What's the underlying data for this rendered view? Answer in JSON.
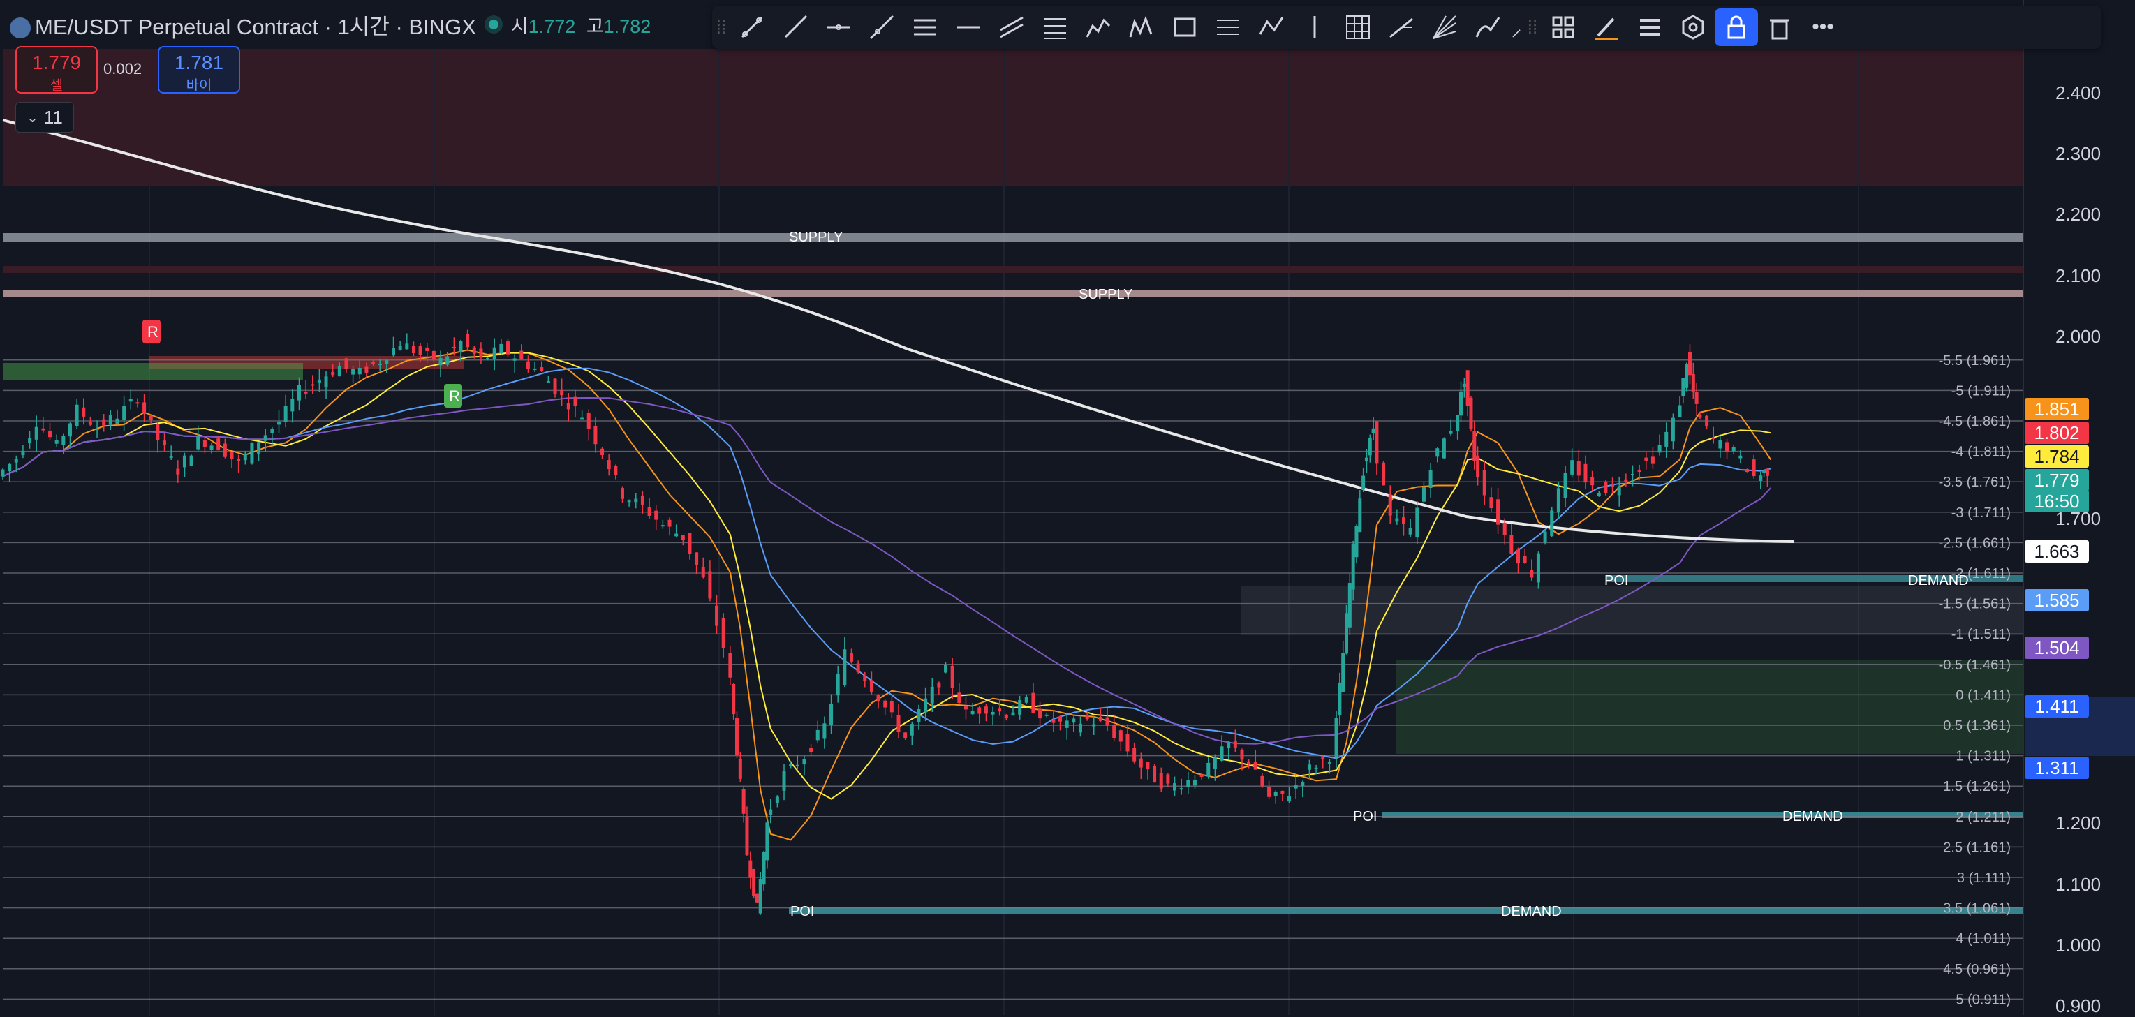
{
  "header": {
    "title": "ME/USDT Perpetual Contract · 1시간 · BINGX",
    "open_label": "시",
    "open_value": "1.772",
    "high_label": "고",
    "high_value": "1.782"
  },
  "trade": {
    "sell_price": "1.779",
    "sell_label": "셀",
    "spread": "0.002",
    "buy_price": "1.781",
    "buy_label": "바이"
  },
  "indicators_toggle": {
    "count": "11"
  },
  "toolbar": {
    "tools": [
      "trend-line",
      "ray",
      "horizontal-ray",
      "extended-line",
      "parallel-channel",
      "horizontal-line",
      "parallel-channels",
      "fib-retracement",
      "elliott-wave",
      "xabcd-pattern",
      "rectangle",
      "regression-trend",
      "abcd-pattern",
      "vertical-line",
      "grid",
      "pitchfork",
      "fan",
      "brush",
      "text"
    ],
    "right_tools": [
      "layout-icon",
      "pen-icon",
      "menu-icon",
      "settings-hex-icon",
      "lock-icon",
      "trash-icon",
      "more-icon"
    ]
  },
  "price_axis": {
    "ticks": [
      "2.400",
      "2.300",
      "2.200",
      "2.100",
      "2.000",
      "1.700",
      "1.200",
      "1.100",
      "1.000",
      "0.900"
    ],
    "tags": [
      {
        "value": "1.851",
        "color": "#f7931a"
      },
      {
        "value": "1.802",
        "color": "#f23645"
      },
      {
        "value": "1.784",
        "color": "#ffeb3b"
      },
      {
        "value": "1.779",
        "color": "#26a69a"
      },
      {
        "value": "16:50",
        "color": "#26a69a"
      },
      {
        "value": "1.663",
        "color": "#ffffff"
      },
      {
        "value": "1.585",
        "color": "#5b9cf6"
      },
      {
        "value": "1.504",
        "color": "#7e57c2"
      },
      {
        "value": "1.411",
        "color": "#2962ff"
      },
      {
        "value": "1.311",
        "color": "#2962ff"
      }
    ]
  },
  "fib_levels": [
    {
      "label": "-5.5 (1.961)",
      "price": 1.961
    },
    {
      "label": "-5 (1.911)",
      "price": 1.911
    },
    {
      "label": "-4.5 (1.861)",
      "price": 1.861
    },
    {
      "label": "-4 (1.811)",
      "price": 1.811
    },
    {
      "label": "-3.5 (1.761)",
      "price": 1.761
    },
    {
      "label": "-3 (1.711)",
      "price": 1.711
    },
    {
      "label": "-2.5 (1.661)",
      "price": 1.661
    },
    {
      "label": "-2 (1.611)",
      "price": 1.611
    },
    {
      "label": "-1.5 (1.561)",
      "price": 1.561
    },
    {
      "label": "-1 (1.511)",
      "price": 1.511
    },
    {
      "label": "-0.5 (1.461)",
      "price": 1.461
    },
    {
      "label": "0 (1.411)",
      "price": 1.411
    },
    {
      "label": "0.5 (1.361)",
      "price": 1.361
    },
    {
      "label": "1 (1.311)",
      "price": 1.311
    },
    {
      "label": "1.5 (1.261)",
      "price": 1.261
    },
    {
      "label": "2 (1.211)",
      "price": 1.211
    },
    {
      "label": "2.5 (1.161)",
      "price": 1.161
    },
    {
      "label": "3 (1.111)",
      "price": 1.111
    },
    {
      "label": "3.5 (1.061)",
      "price": 1.061
    },
    {
      "label": "4 (1.011)",
      "price": 1.011
    },
    {
      "label": "4.5 (0.961)",
      "price": 0.961
    },
    {
      "label": "5 (0.911)",
      "price": 0.911
    }
  ],
  "zone_labels": {
    "supply": "SUPPLY",
    "demand": "DEMAND",
    "poi": "POI",
    "marker_r": "R"
  },
  "price_series": [
    [
      0,
      1.77
    ],
    [
      0.01,
      1.8
    ],
    [
      0.02,
      1.86
    ],
    [
      0.03,
      1.82
    ],
    [
      0.04,
      1.88
    ],
    [
      0.05,
      1.85
    ],
    [
      0.06,
      1.87
    ],
    [
      0.07,
      1.9
    ],
    [
      0.08,
      1.83
    ],
    [
      0.09,
      1.78
    ],
    [
      0.1,
      1.83
    ],
    [
      0.11,
      1.82
    ],
    [
      0.12,
      1.79
    ],
    [
      0.13,
      1.83
    ],
    [
      0.14,
      1.86
    ],
    [
      0.15,
      1.91
    ],
    [
      0.16,
      1.93
    ],
    [
      0.17,
      1.95
    ],
    [
      0.18,
      1.94
    ],
    [
      0.19,
      1.96
    ],
    [
      0.2,
      1.99
    ],
    [
      0.21,
      1.97
    ],
    [
      0.22,
      1.96
    ],
    [
      0.23,
      1.99
    ],
    [
      0.24,
      1.96
    ],
    [
      0.25,
      1.98
    ],
    [
      0.26,
      1.96
    ],
    [
      0.27,
      1.94
    ],
    [
      0.28,
      1.9
    ],
    [
      0.29,
      1.87
    ],
    [
      0.3,
      1.81
    ],
    [
      0.31,
      1.74
    ],
    [
      0.32,
      1.72
    ],
    [
      0.33,
      1.69
    ],
    [
      0.34,
      1.67
    ],
    [
      0.35,
      1.6
    ],
    [
      0.36,
      1.49
    ],
    [
      0.365,
      1.32
    ],
    [
      0.37,
      1.15
    ],
    [
      0.375,
      1.06
    ],
    [
      0.38,
      1.2
    ],
    [
      0.39,
      1.28
    ],
    [
      0.4,
      1.31
    ],
    [
      0.41,
      1.36
    ],
    [
      0.42,
      1.48
    ],
    [
      0.43,
      1.44
    ],
    [
      0.44,
      1.39
    ],
    [
      0.45,
      1.34
    ],
    [
      0.46,
      1.4
    ],
    [
      0.47,
      1.45
    ],
    [
      0.48,
      1.38
    ],
    [
      0.49,
      1.39
    ],
    [
      0.5,
      1.38
    ],
    [
      0.51,
      1.4
    ],
    [
      0.52,
      1.37
    ],
    [
      0.53,
      1.36
    ],
    [
      0.54,
      1.37
    ],
    [
      0.55,
      1.36
    ],
    [
      0.56,
      1.32
    ],
    [
      0.57,
      1.28
    ],
    [
      0.58,
      1.26
    ],
    [
      0.59,
      1.27
    ],
    [
      0.6,
      1.29
    ],
    [
      0.61,
      1.33
    ],
    [
      0.62,
      1.3
    ],
    [
      0.63,
      1.24
    ],
    [
      0.64,
      1.25
    ],
    [
      0.65,
      1.29
    ],
    [
      0.66,
      1.31
    ],
    [
      0.665,
      1.48
    ],
    [
      0.67,
      1.65
    ],
    [
      0.675,
      1.78
    ],
    [
      0.68,
      1.85
    ],
    [
      0.69,
      1.7
    ],
    [
      0.7,
      1.68
    ],
    [
      0.71,
      1.79
    ],
    [
      0.72,
      1.85
    ],
    [
      0.725,
      1.93
    ],
    [
      0.73,
      1.8
    ],
    [
      0.74,
      1.72
    ],
    [
      0.75,
      1.65
    ],
    [
      0.76,
      1.61
    ],
    [
      0.77,
      1.72
    ],
    [
      0.78,
      1.79
    ],
    [
      0.79,
      1.75
    ],
    [
      0.8,
      1.75
    ],
    [
      0.81,
      1.78
    ],
    [
      0.82,
      1.8
    ],
    [
      0.83,
      1.86
    ],
    [
      0.835,
      1.96
    ],
    [
      0.84,
      1.88
    ],
    [
      0.85,
      1.83
    ],
    [
      0.86,
      1.81
    ],
    [
      0.87,
      1.77
    ],
    [
      0.875,
      1.779
    ]
  ]
}
